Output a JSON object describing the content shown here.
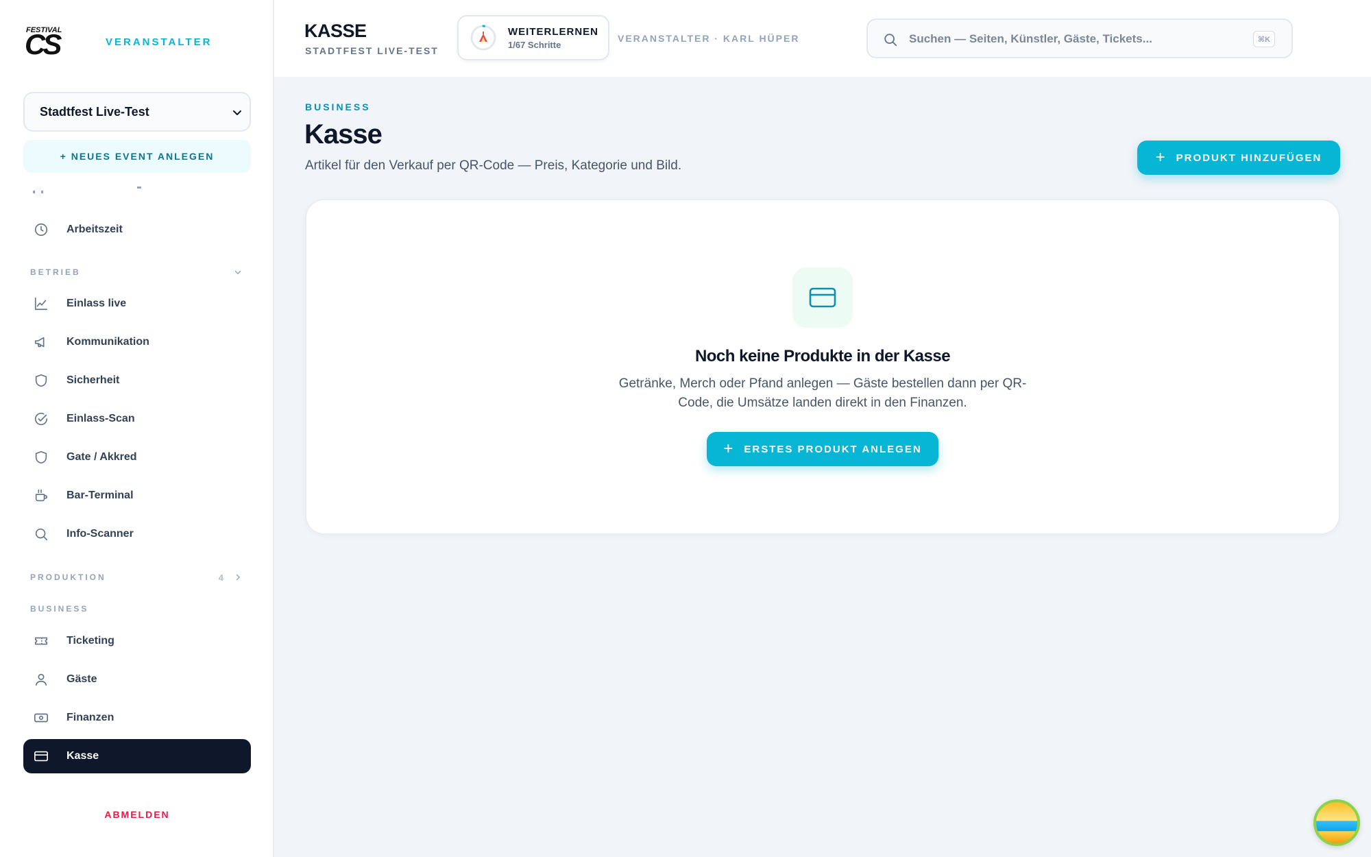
{
  "brand": {
    "logo_top": "FESTIVAL",
    "logo_main": "CS",
    "label": "VERANSTALTER"
  },
  "sidebar": {
    "event_select": "Stadtfest Live-Test",
    "new_event": "+ NEUES EVENT ANLEGEN",
    "items_top": [
      {
        "label": "Arbeitszeit",
        "icon": "clock-icon"
      }
    ],
    "section_betrieb": "BETRIEB",
    "betrieb_items": [
      {
        "label": "Einlass live",
        "icon": "chart-line-icon"
      },
      {
        "label": "Kommunikation",
        "icon": "megaphone-icon"
      },
      {
        "label": "Sicherheit",
        "icon": "shield-icon"
      },
      {
        "label": "Einlass-Scan",
        "icon": "check-circle-icon"
      },
      {
        "label": "Gate / Akkred",
        "icon": "shield-icon"
      },
      {
        "label": "Bar-Terminal",
        "icon": "cup-icon"
      },
      {
        "label": "Info-Scanner",
        "icon": "search-icon"
      }
    ],
    "section_produktion": "PRODUKTION",
    "produktion_count": "4",
    "section_business": "BUSINESS",
    "business_items": [
      {
        "label": "Ticketing",
        "icon": "ticket-icon"
      },
      {
        "label": "Gäste",
        "icon": "user-icon"
      },
      {
        "label": "Finanzen",
        "icon": "banknote-icon"
      },
      {
        "label": "Kasse",
        "icon": "credit-card-icon",
        "active": true
      }
    ],
    "logout": "ABMELDEN"
  },
  "header": {
    "title": "KASSE",
    "subtitle": "STADTFEST LIVE-TEST",
    "learn_title": "WEITERLERNEN",
    "learn_progress": "1/67 Schritte",
    "organizer": "VERANSTALTER · KARL HÜPER",
    "search_placeholder": "Suchen — Seiten, Künstler, Gäste, Tickets...",
    "search_shortcut": "⌘K"
  },
  "main": {
    "kicker": "BUSINESS",
    "title": "Kasse",
    "lead": "Artikel für den Verkauf per QR-Code — Preis, Kategorie und Bild.",
    "add_button": "PRODUKT HINZUFÜGEN",
    "empty_title": "Noch keine Produkte in der Kasse",
    "empty_text": "Getränke, Merch oder Pfand anlegen — Gäste bestellen dann per QR-Code, die Umsätze landen direkt in den Finanzen.",
    "cta_button": "ERSTES PRODUKT ANLEGEN"
  },
  "colors": {
    "accent": "#06b6d4",
    "dark": "#0f172a",
    "danger": "#e11d48"
  }
}
